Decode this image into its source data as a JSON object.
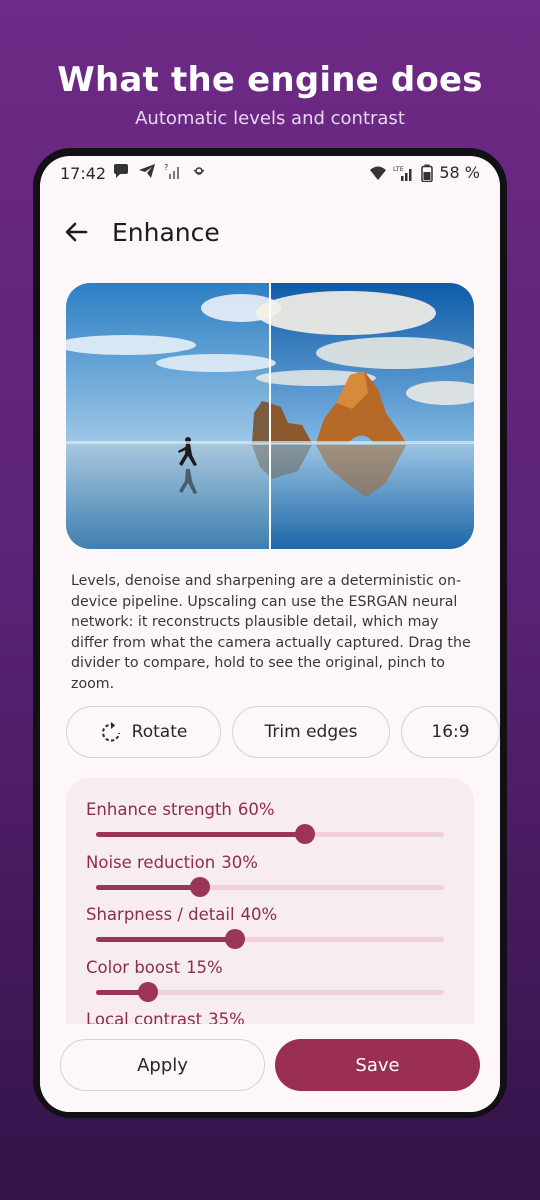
{
  "promo": {
    "title": "What the engine does",
    "subtitle": "Automatic levels and contrast"
  },
  "status_bar": {
    "time": "17:42",
    "battery": "58 %",
    "network_label": "LTE",
    "left_icons": [
      "chat-bubble-icon",
      "telegram-icon",
      "signal-unknown-icon",
      "notification-icon"
    ],
    "right_icons": [
      "wifi-icon",
      "lte-signal-icon",
      "battery-icon"
    ]
  },
  "header": {
    "title": "Enhance",
    "back_icon": "arrow-left-icon"
  },
  "preview": {
    "description": "Levels, denoise and sharpening are a deterministic on-device pipeline. Upscaling can use the ESRGAN neural network: it reconstructs plausible detail, which may differ from what the camera actually captured. Drag the divider to compare, hold to see the original, pinch to zoom.",
    "divider_position": 0.5
  },
  "chips": [
    {
      "label": "Rotate",
      "icon": "rotate-icon"
    },
    {
      "label": "Trim edges"
    },
    {
      "label": "16:9"
    }
  ],
  "sliders": [
    {
      "label": "Enhance strength",
      "value_text": "60%",
      "value": 0.6
    },
    {
      "label": "Noise reduction",
      "value_text": "30%",
      "value": 0.3
    },
    {
      "label": "Sharpness / detail",
      "value_text": "40%",
      "value": 0.4
    },
    {
      "label": "Color boost",
      "value_text": "15%",
      "value": 0.15
    },
    {
      "label": "Local contrast",
      "value_text": "35%",
      "value": 0.35
    }
  ],
  "actions": {
    "apply_label": "Apply",
    "save_label": "Save"
  },
  "colors": {
    "accent": "#9b2f53",
    "track": "#f0cfd9",
    "background_top": "#6e2a86"
  }
}
